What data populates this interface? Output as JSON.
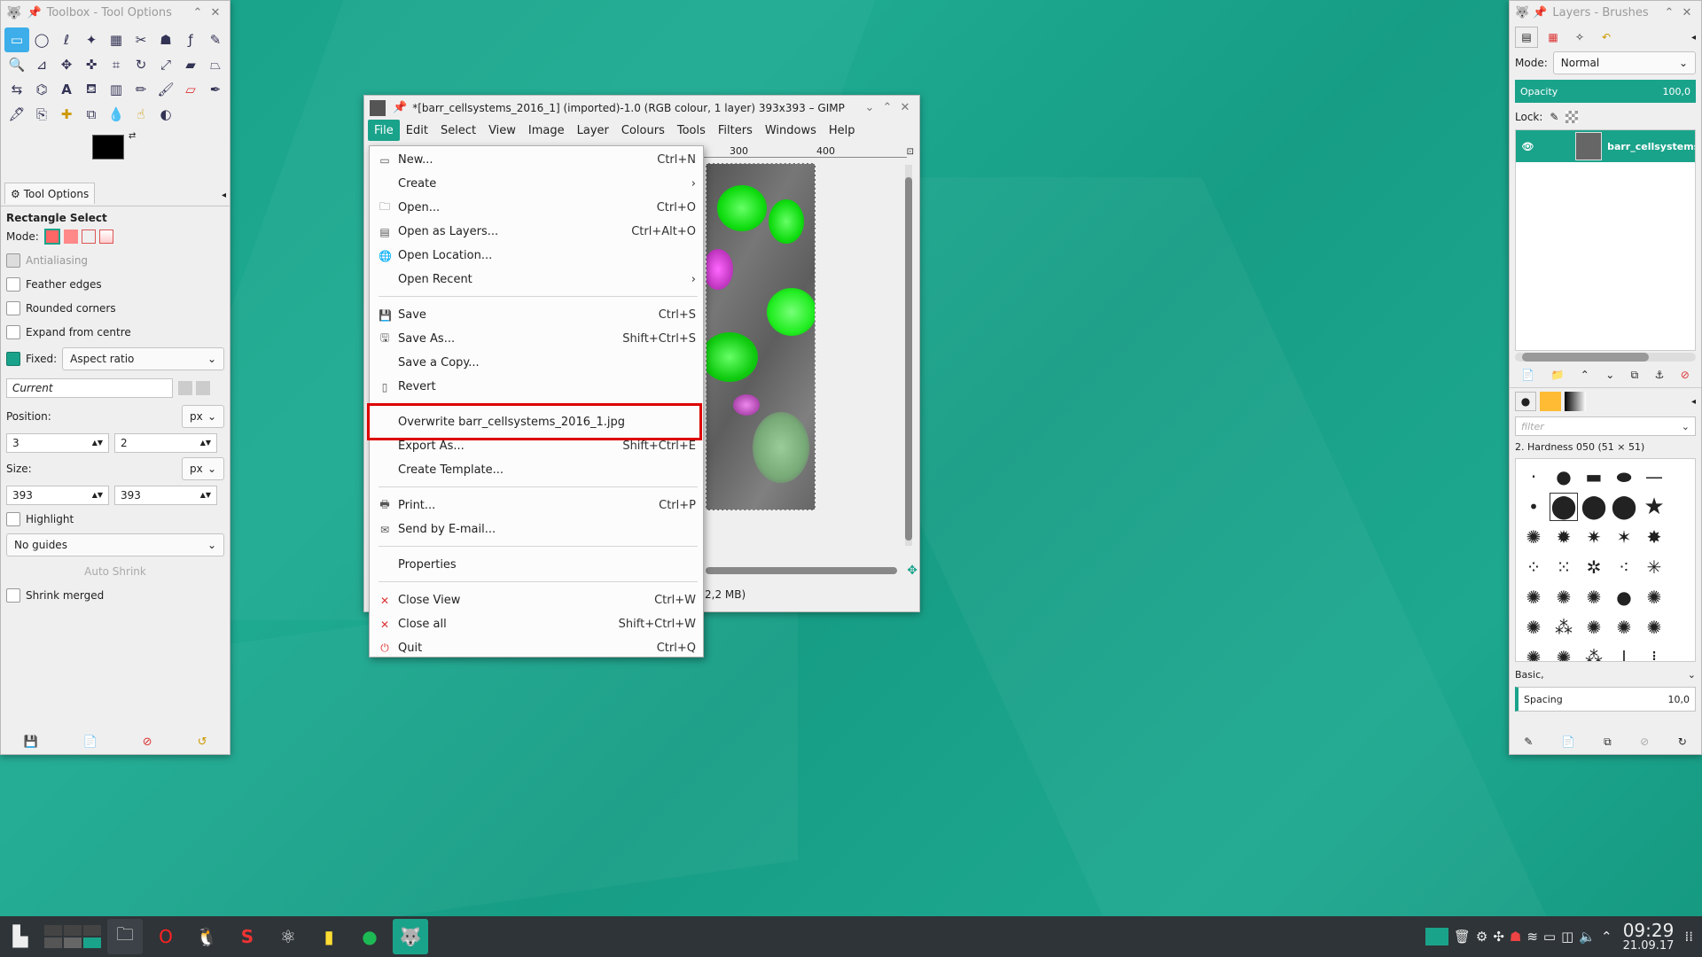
{
  "toolbox": {
    "title": "Toolbox - Tool Options",
    "tab_label": "Tool Options",
    "tool_name": "Rectangle Select",
    "mode_label": "Mode:",
    "antialiasing": "Antialiasing",
    "feather_edges": "Feather edges",
    "rounded_corners": "Rounded corners",
    "expand_from_centre": "Expand from centre",
    "fixed_label": "Fixed:",
    "fixed_value": "Aspect ratio",
    "current_value": "Current",
    "position_label": "Position:",
    "position_unit": "px",
    "position_x": "3",
    "position_y": "2",
    "size_label": "Size:",
    "size_unit": "px",
    "size_w": "393",
    "size_h": "393",
    "highlight": "Highlight",
    "guides_value": "No guides",
    "auto_shrink": "Auto Shrink",
    "shrink_merged": "Shrink merged"
  },
  "image_window": {
    "title": "*[barr_cellsystems_2016_1] (imported)-1.0 (RGB colour, 1 layer) 393x393 – GIMP",
    "menu": [
      "File",
      "Edit",
      "Select",
      "View",
      "Image",
      "Layer",
      "Colours",
      "Tools",
      "Filters",
      "Windows",
      "Help"
    ],
    "ruler_marks": [
      "300",
      "400"
    ],
    "status_text": "2,2 MB)"
  },
  "file_menu": {
    "items": [
      {
        "label": "New...",
        "accel": "Ctrl+N",
        "icon": "new-icon"
      },
      {
        "label": "Create",
        "accel": "›",
        "icon": ""
      },
      {
        "label": "Open...",
        "accel": "Ctrl+O",
        "icon": "open-icon"
      },
      {
        "label": "Open as Layers...",
        "accel": "Ctrl+Alt+O",
        "icon": "layers-icon"
      },
      {
        "label": "Open Location...",
        "accel": "",
        "icon": "globe-icon"
      },
      {
        "label": "Open Recent",
        "accel": "›",
        "icon": ""
      },
      {
        "label": "Save",
        "accel": "Ctrl+S",
        "icon": "save-icon"
      },
      {
        "label": "Save As...",
        "accel": "Shift+Ctrl+S",
        "icon": "save-as-icon"
      },
      {
        "label": "Save a Copy...",
        "accel": "",
        "icon": ""
      },
      {
        "label": "Revert",
        "accel": "",
        "icon": "revert-icon"
      },
      {
        "label": "Overwrite barr_cellsystems_2016_1.jpg",
        "accel": "",
        "icon": ""
      },
      {
        "label": "Export As...",
        "accel": "Shift+Ctrl+E",
        "icon": ""
      },
      {
        "label": "Create Template...",
        "accel": "",
        "icon": ""
      },
      {
        "label": "Print...",
        "accel": "Ctrl+P",
        "icon": "print-icon"
      },
      {
        "label": "Send by E-mail...",
        "accel": "",
        "icon": "mail-icon"
      },
      {
        "label": "Properties",
        "accel": "",
        "icon": ""
      },
      {
        "label": "Close View",
        "accel": "Ctrl+W",
        "icon": "close-icon"
      },
      {
        "label": "Close all",
        "accel": "Shift+Ctrl+W",
        "icon": "close-icon"
      },
      {
        "label": "Quit",
        "accel": "Ctrl+Q",
        "icon": "quit-icon"
      }
    ]
  },
  "layers_panel": {
    "title": "Layers - Brushes",
    "mode_label": "Mode:",
    "mode_value": "Normal",
    "opacity_label": "Opacity",
    "opacity_value": "100,0",
    "lock_label": "Lock:",
    "layer_name": "barr_cellsystems",
    "filter_placeholder": "filter",
    "brush_name": "2. Hardness 050 (51 × 51)",
    "brush_set": "Basic,",
    "spacing_label": "Spacing",
    "spacing_value": "10,0"
  },
  "taskbar": {
    "time": "09:29",
    "date": "21.09.17"
  },
  "colors": {
    "accent": "#1aa38b",
    "highlight_box": "#dd0000"
  }
}
